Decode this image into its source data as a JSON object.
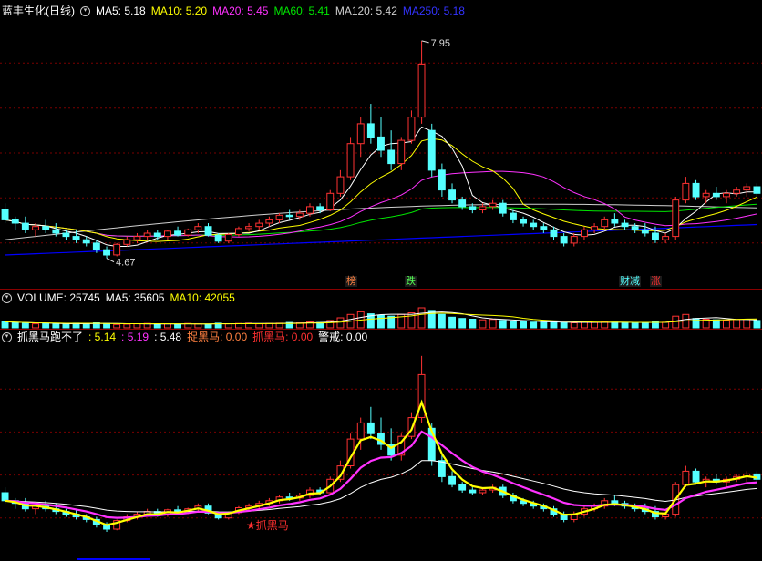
{
  "colors": {
    "bg": "#000000",
    "grid": "#7a0000",
    "up": "#ff3232",
    "down": "#54ffff",
    "ma5": "#ffffff",
    "ma10": "#ffff00",
    "ma20": "#ff32ff",
    "ma60": "#00e600",
    "ma120": "#d0d0d0",
    "ma250": "#0000ff",
    "orange": "#ff8040",
    "red": "#ff3030"
  },
  "header": {
    "title": "蓝丰生化(日线)",
    "ma5": "MA5: 5.18",
    "ma10": "MA10: 5.20",
    "ma20": "MA20: 5.45",
    "ma60": "MA60: 5.41",
    "ma120": "MA120: 5.42",
    "ma250": "MA250: 5.18"
  },
  "annotations": {
    "high": "7.95",
    "low": "4.67"
  },
  "badges": {
    "b1": "榜",
    "b2": "跌",
    "b3": "财减",
    "b4": "涨"
  },
  "volume_header": {
    "label": "VOLUME: 25745",
    "ma5": "MA5: 35605",
    "ma10": "MA10: 42055"
  },
  "ind_header": {
    "name": "抓黑马跑不了",
    "v1": ": 5.14",
    "v2": ": 5.19",
    "v3": ": 5.48",
    "catch": "捉黑马: 0.00",
    "grab": "抓黑马: 0.00",
    "alert": "警戒: 0.00"
  },
  "signal_label": "抓黑马",
  "chart_data": {
    "type": "candlestick",
    "title": "蓝丰生化(日线)",
    "ylim": [
      4.5,
      8.1
    ],
    "ohlc": [
      [
        5.4,
        5.5,
        5.2,
        5.25
      ],
      [
        5.25,
        5.3,
        5.1,
        5.2
      ],
      [
        5.2,
        5.3,
        5.05,
        5.1
      ],
      [
        5.1,
        5.2,
        5.0,
        5.15
      ],
      [
        5.15,
        5.25,
        5.05,
        5.1
      ],
      [
        5.1,
        5.2,
        5.0,
        5.05
      ],
      [
        5.05,
        5.1,
        4.95,
        5.0
      ],
      [
        5.0,
        5.1,
        4.9,
        4.95
      ],
      [
        4.95,
        5.0,
        4.85,
        4.9
      ],
      [
        4.9,
        4.95,
        4.75,
        4.8
      ],
      [
        4.8,
        4.85,
        4.67,
        4.72
      ],
      [
        4.72,
        4.9,
        4.7,
        4.88
      ],
      [
        4.88,
        5.0,
        4.85,
        4.95
      ],
      [
        4.95,
        5.05,
        4.9,
        5.0
      ],
      [
        5.0,
        5.1,
        4.95,
        5.05
      ],
      [
        5.05,
        5.1,
        4.95,
        5.0
      ],
      [
        5.0,
        5.1,
        4.95,
        5.08
      ],
      [
        5.08,
        5.15,
        5.0,
        5.02
      ],
      [
        5.02,
        5.12,
        5.0,
        5.1
      ],
      [
        5.1,
        5.2,
        5.05,
        5.15
      ],
      [
        5.15,
        5.2,
        5.0,
        5.02
      ],
      [
        5.02,
        5.05,
        4.9,
        4.93
      ],
      [
        4.93,
        5.05,
        4.9,
        5.03
      ],
      [
        5.03,
        5.15,
        5.0,
        5.12
      ],
      [
        5.12,
        5.2,
        5.08,
        5.15
      ],
      [
        5.15,
        5.25,
        5.1,
        5.2
      ],
      [
        5.2,
        5.3,
        5.15,
        5.25
      ],
      [
        5.25,
        5.35,
        5.2,
        5.32
      ],
      [
        5.32,
        5.4,
        5.25,
        5.3
      ],
      [
        5.3,
        5.4,
        5.25,
        5.35
      ],
      [
        5.35,
        5.5,
        5.3,
        5.45
      ],
      [
        5.45,
        5.5,
        5.35,
        5.4
      ],
      [
        5.4,
        5.7,
        5.38,
        5.65
      ],
      [
        5.65,
        6.0,
        5.6,
        5.9
      ],
      [
        5.9,
        6.5,
        5.85,
        6.4
      ],
      [
        6.4,
        6.8,
        6.2,
        6.7
      ],
      [
        6.7,
        7.0,
        6.4,
        6.5
      ],
      [
        6.5,
        6.8,
        6.2,
        6.3
      ],
      [
        6.3,
        6.6,
        6.0,
        6.1
      ],
      [
        6.1,
        6.5,
        6.0,
        6.45
      ],
      [
        6.45,
        6.9,
        6.4,
        6.8
      ],
      [
        6.8,
        7.95,
        6.7,
        7.6
      ],
      [
        6.6,
        6.7,
        5.9,
        6.0
      ],
      [
        6.0,
        6.1,
        5.6,
        5.7
      ],
      [
        5.7,
        5.8,
        5.5,
        5.55
      ],
      [
        5.55,
        5.6,
        5.4,
        5.45
      ],
      [
        5.45,
        5.5,
        5.35,
        5.4
      ],
      [
        5.4,
        5.5,
        5.35,
        5.45
      ],
      [
        5.45,
        5.55,
        5.4,
        5.5
      ],
      [
        5.5,
        5.55,
        5.3,
        5.35
      ],
      [
        5.35,
        5.4,
        5.2,
        5.25
      ],
      [
        5.25,
        5.3,
        5.15,
        5.2
      ],
      [
        5.2,
        5.25,
        5.1,
        5.15
      ],
      [
        5.15,
        5.2,
        5.05,
        5.1
      ],
      [
        5.1,
        5.15,
        4.95,
        5.0
      ],
      [
        5.0,
        5.05,
        4.85,
        4.9
      ],
      [
        4.9,
        5.05,
        4.85,
        5.0
      ],
      [
        5.0,
        5.15,
        4.95,
        5.1
      ],
      [
        5.1,
        5.2,
        5.05,
        5.15
      ],
      [
        5.15,
        5.3,
        5.1,
        5.25
      ],
      [
        5.25,
        5.35,
        5.15,
        5.2
      ],
      [
        5.2,
        5.25,
        5.1,
        5.15
      ],
      [
        5.15,
        5.2,
        5.05,
        5.1
      ],
      [
        5.1,
        5.2,
        5.0,
        5.05
      ],
      [
        5.05,
        5.15,
        4.9,
        4.95
      ],
      [
        4.95,
        5.05,
        4.9,
        5.0
      ],
      [
        5.0,
        5.6,
        4.95,
        5.55
      ],
      [
        5.55,
        5.9,
        5.5,
        5.8
      ],
      [
        5.8,
        5.85,
        5.55,
        5.6
      ],
      [
        5.6,
        5.7,
        5.5,
        5.65
      ],
      [
        5.65,
        5.75,
        5.55,
        5.6
      ],
      [
        5.6,
        5.7,
        5.5,
        5.65
      ],
      [
        5.65,
        5.75,
        5.6,
        5.7
      ],
      [
        5.7,
        5.8,
        5.6,
        5.75
      ],
      [
        5.75,
        5.8,
        5.6,
        5.65
      ]
    ],
    "volume": [
      18,
      16,
      14,
      12,
      13,
      12,
      11,
      14,
      12,
      15,
      13,
      10,
      11,
      12,
      13,
      11,
      12,
      11,
      13,
      12,
      11,
      14,
      12,
      13,
      14,
      12,
      13,
      14,
      16,
      15,
      18,
      16,
      22,
      30,
      40,
      48,
      42,
      38,
      35,
      40,
      45,
      60,
      52,
      40,
      32,
      28,
      26,
      24,
      25,
      22,
      20,
      18,
      17,
      16,
      18,
      16,
      15,
      17,
      16,
      18,
      17,
      15,
      16,
      15,
      19,
      17,
      35,
      40,
      28,
      26,
      24,
      23,
      25,
      26,
      22
    ],
    "series": [
      {
        "name": "MA5",
        "value": 5.18
      },
      {
        "name": "MA10",
        "value": 5.2
      },
      {
        "name": "MA20",
        "value": 5.45
      },
      {
        "name": "MA60",
        "value": 5.41
      },
      {
        "name": "MA120",
        "value": 5.42
      },
      {
        "name": "MA250",
        "value": 5.18
      }
    ],
    "max_label": 7.95,
    "min_label": 4.67
  }
}
